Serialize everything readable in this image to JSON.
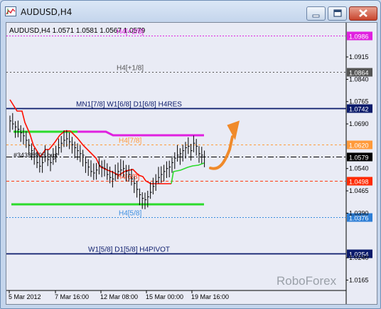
{
  "window": {
    "title": "AUDUSD,H4"
  },
  "chart": {
    "info": "AUDUSD,H4  1.0571 1.0581 1.0567 1.0579",
    "order_label": "#34338905 buy",
    "watermark": "RoboForex",
    "colors": {
      "background": "#e9ebf5",
      "price_line": "#000000",
      "arrow": "#f08a2a",
      "upper_band": "#e020e0",
      "lower_band": "#2bdb2b"
    },
    "levels": [
      {
        "label": "H4[+2/8]",
        "price": "1.0986",
        "color": "#e020e0",
        "tag_bg": "#e020e0",
        "tag_fg": "#ffffff"
      },
      {
        "label": "H4[+1/8]",
        "price": "1.0864",
        "color": "#555555",
        "tag_bg": "#555555",
        "tag_fg": "#ffffff"
      },
      {
        "label": "MN1[7/8] W1[6/8] D1[6/8] H4RES",
        "price": "1.0742",
        "color": "#0b1b6b",
        "tag_bg": "#0b1b6b",
        "tag_fg": "#ffffff"
      },
      {
        "label": "H4[7/8]",
        "price": "1.0620",
        "color": "#ff9a3a",
        "tag_bg": "#ff9a3a",
        "tag_fg": "#ffffff"
      },
      {
        "label": "",
        "price": "1.0579",
        "color": "#000000",
        "tag_bg": "#000000",
        "tag_fg": "#ffffff"
      },
      {
        "label": "H4[6/8]",
        "price": "1.0498",
        "color": "#ff3a10",
        "tag_bg": "#ff2a00",
        "tag_fg": "#ffffff"
      },
      {
        "label": "H4[5/8]",
        "price": "1.0376",
        "color": "#3a8ee0",
        "tag_bg": "#2f7fd6",
        "tag_fg": "#ffffff"
      },
      {
        "label": "W1[5/8] D1[5/8] H4PIVOT",
        "price": "1.0254",
        "color": "#0b1b6b",
        "tag_bg": "#0b1b6b",
        "tag_fg": "#ffffff"
      }
    ],
    "y_ticks": [
      "1.0915",
      "1.0840",
      "1.0765",
      "1.0690",
      "1.0540",
      "1.0465",
      "1.0390",
      "1.0240",
      "1.0165"
    ],
    "x_ticks": [
      "5 Mar 2012",
      "7 Mar 16:00",
      "12 Mar 08:00",
      "15 Mar 00:00",
      "19 Mar 16:00"
    ]
  }
}
